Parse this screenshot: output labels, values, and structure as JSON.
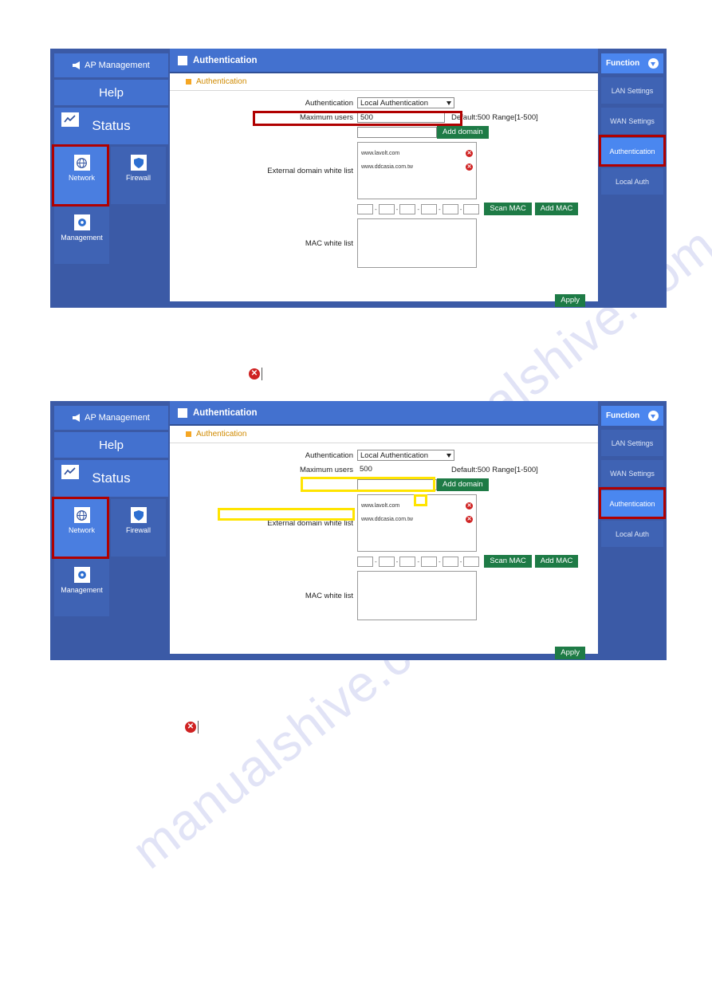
{
  "document": {
    "watermark": "manualshive.com",
    "broken_image_markers": 2
  },
  "screenshots": [
    {
      "id": "screenshot-1",
      "highlight_style": "red",
      "left_sidebar": {
        "ap_management": "AP Management",
        "help": "Help",
        "status": "Status",
        "status_icon": "chart-line-icon",
        "tiles": [
          {
            "label": "Network",
            "icon": "globe-icon",
            "active": true
          },
          {
            "label": "Firewall",
            "icon": "shield-icon",
            "active": false
          },
          {
            "label": "Management",
            "icon": "gear-icon",
            "active": false
          }
        ]
      },
      "main": {
        "window_title": "Authentication",
        "window_icon": "window-square-icon",
        "section_title": "Authentication",
        "section_icon": "orange-square-icon",
        "fields": {
          "authentication_label": "Authentication",
          "authentication_value": "Local Authentication",
          "authentication_options": [
            "Local Authentication"
          ],
          "maximum_users_label": "Maximum users",
          "maximum_users_value": "500",
          "maximum_users_hint": "Default:500 Range[1-500]",
          "domain_input_value": "",
          "domain_input_placeholder": "",
          "add_domain_button": "Add domain",
          "external_domain_label": "External domain white list",
          "domains": [
            "www.lavolt.com",
            "www.ddcasia.com.tw"
          ],
          "mac_white_list_label": "MAC white list",
          "mac_octets": [
            "",
            "",
            "",
            "",
            "",
            ""
          ],
          "mac_separator": "-",
          "scan_mac_button": "Scan MAC",
          "add_mac_button": "Add MAC",
          "apply_button": "Apply"
        }
      },
      "right_sidebar": {
        "function_label": "Function",
        "function_icon": "chevron-down-circle-icon",
        "items": [
          {
            "label": "LAN Settings",
            "active": false
          },
          {
            "label": "WAN Settings",
            "active": false
          },
          {
            "label": "Authentication",
            "active": true
          },
          {
            "label": "Local Auth",
            "active": false
          }
        ]
      }
    },
    {
      "id": "screenshot-2",
      "highlight_style": "yellow",
      "left_sidebar": {
        "ap_management": "AP Management",
        "help": "Help",
        "status": "Status",
        "status_icon": "chart-line-icon",
        "tiles": [
          {
            "label": "Network",
            "icon": "globe-icon",
            "active": true
          },
          {
            "label": "Firewall",
            "icon": "shield-icon",
            "active": false
          },
          {
            "label": "Management",
            "icon": "gear-icon",
            "active": false
          }
        ]
      },
      "main": {
        "window_title": "Authentication",
        "window_icon": "window-square-icon",
        "section_title": "Authentication",
        "section_icon": "orange-square-icon",
        "fields": {
          "authentication_label": "Authentication",
          "authentication_value": "Local Authentication",
          "authentication_options": [
            "Local Authentication"
          ],
          "maximum_users_label": "Maximum users",
          "maximum_users_value": "500",
          "maximum_users_hint": "Default:500 Range[1-500]",
          "domain_input_value": "",
          "domain_input_placeholder": "",
          "add_domain_button": "Add domain",
          "external_domain_label": "External domain white list",
          "domains": [
            "www.lavolt.com",
            "www.ddcasia.com.tw"
          ],
          "mac_white_list_label": "MAC white list",
          "mac_octets": [
            "",
            "",
            "",
            "",
            "",
            ""
          ],
          "mac_separator": "-",
          "scan_mac_button": "Scan MAC",
          "add_mac_button": "Add MAC",
          "apply_button": "Apply"
        }
      },
      "right_sidebar": {
        "function_label": "Function",
        "function_icon": "chevron-down-circle-icon",
        "items": [
          {
            "label": "LAN Settings",
            "active": false
          },
          {
            "label": "WAN Settings",
            "active": false
          },
          {
            "label": "Authentication",
            "active": true
          },
          {
            "label": "Local Auth",
            "active": false
          }
        ]
      }
    }
  ]
}
